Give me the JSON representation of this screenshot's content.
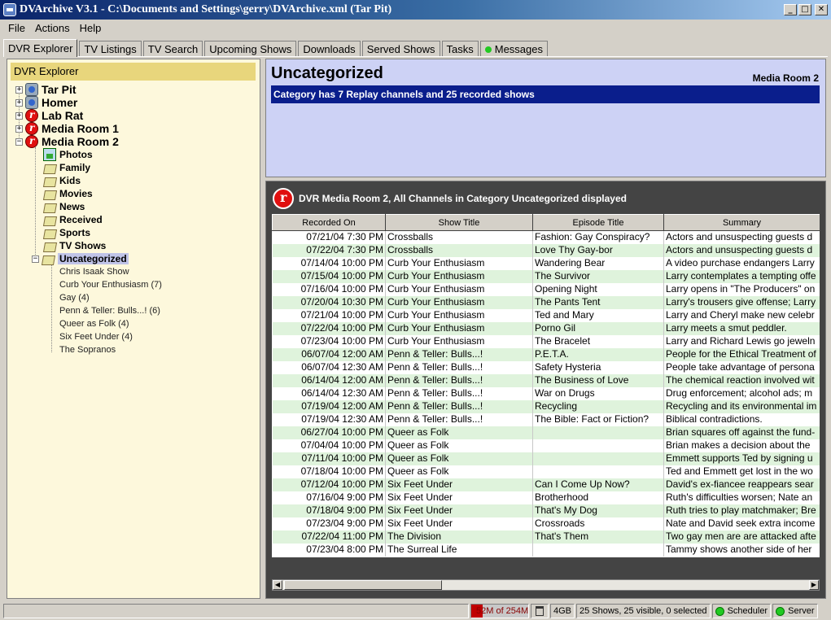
{
  "window": {
    "title": "DVArchive V3.1 - C:\\Documents and Settings\\gerry\\DVArchive.xml (Tar Pit)",
    "minimize": "_",
    "maximize": "□",
    "close": "✕"
  },
  "menu": [
    "File",
    "Actions",
    "Help"
  ],
  "tabs": [
    "DVR Explorer",
    "TV Listings",
    "TV Search",
    "Upcoming Shows",
    "Downloads",
    "Served Shows",
    "Tasks",
    "Messages"
  ],
  "explorer": {
    "heading": "DVR Explorer",
    "dvrs": [
      "Tar Pit",
      "Homer",
      "Lab Rat",
      "Media Room 1",
      "Media Room 2"
    ],
    "categories": [
      "Photos",
      "Family",
      "Kids",
      "Movies",
      "News",
      "Received",
      "Sports",
      "TV Shows",
      "Uncategorized"
    ],
    "shows": [
      "Chris Isaak Show",
      "Curb Your Enthusiasm (7)",
      "Gay (4)",
      "Penn & Teller: Bulls...! (6)",
      "Queer as Folk (4)",
      "Six Feet Under (4)",
      "The Sopranos"
    ]
  },
  "category": {
    "title": "Uncategorized",
    "dvr": "Media Room 2",
    "info": "Category has 7 Replay channels and 25 recorded shows"
  },
  "shows_panel": {
    "heading": "DVR Media Room 2, All Channels in Category Uncategorized displayed"
  },
  "table": {
    "columns": [
      "Recorded On",
      "Show Title",
      "Episode Title",
      "Summary"
    ],
    "rows": [
      [
        "07/21/04 7:30 PM",
        "Crossballs",
        "Fashion: Gay Conspiracy?",
        "Actors and unsuspecting guests d"
      ],
      [
        "07/22/04 7:30 PM",
        "Crossballs",
        "Love Thy Gay-bor",
        "Actors and unsuspecting guests d"
      ],
      [
        "07/14/04 10:00 PM",
        "Curb Your Enthusiasm",
        "Wandering Bear",
        "A video purchase endangers Larry"
      ],
      [
        "07/15/04 10:00 PM",
        "Curb Your Enthusiasm",
        "The Survivor",
        "Larry contemplates a tempting offe"
      ],
      [
        "07/16/04 10:00 PM",
        "Curb Your Enthusiasm",
        "Opening Night",
        "Larry opens in \"The Producers\" on"
      ],
      [
        "07/20/04 10:30 PM",
        "Curb Your Enthusiasm",
        "The Pants Tent",
        "Larry's trousers give offense; Larry"
      ],
      [
        "07/21/04 10:00 PM",
        "Curb Your Enthusiasm",
        "Ted and Mary",
        "Larry and Cheryl make new celebr"
      ],
      [
        "07/22/04 10:00 PM",
        "Curb Your Enthusiasm",
        "Porno Gil",
        "Larry meets a smut peddler."
      ],
      [
        "07/23/04 10:00 PM",
        "Curb Your Enthusiasm",
        "The Bracelet",
        "Larry and Richard Lewis go jeweln"
      ],
      [
        "06/07/04 12:00 AM",
        "Penn & Teller: Bulls...!",
        "P.E.T.A.",
        "People for the Ethical Treatment of"
      ],
      [
        "06/07/04 12:30 AM",
        "Penn & Teller: Bulls...!",
        "Safety Hysteria",
        "People take advantage of persona"
      ],
      [
        "06/14/04 12:00 AM",
        "Penn & Teller: Bulls...!",
        "The Business of Love",
        "The chemical reaction involved wit"
      ],
      [
        "06/14/04 12:30 AM",
        "Penn & Teller: Bulls...!",
        "War on Drugs",
        "Drug enforcement; alcohol ads; m"
      ],
      [
        "07/19/04 12:00 AM",
        "Penn & Teller: Bulls...!",
        "Recycling",
        "Recycling and its environmental im"
      ],
      [
        "07/19/04 12:30 AM",
        "Penn & Teller: Bulls...!",
        "The Bible: Fact or Fiction?",
        "Biblical contradictions."
      ],
      [
        "06/27/04 10:00 PM",
        "Queer as Folk",
        "",
        "Brian squares off against the fund-"
      ],
      [
        "07/04/04 10:00 PM",
        "Queer as Folk",
        "",
        "Brian makes a decision about the"
      ],
      [
        "07/11/04 10:00 PM",
        "Queer as Folk",
        "",
        "Emmett supports Ted by signing u"
      ],
      [
        "07/18/04 10:00 PM",
        "Queer as Folk",
        "",
        "Ted and Emmett get lost in the wo"
      ],
      [
        "07/12/04 10:00 PM",
        "Six Feet Under",
        "Can I Come Up Now?",
        "David's ex-fiancee reappears sear"
      ],
      [
        "07/16/04 9:00 PM",
        "Six Feet Under",
        "Brotherhood",
        "Ruth's difficulties worsen; Nate an"
      ],
      [
        "07/18/04 9:00 PM",
        "Six Feet Under",
        "That's My Dog",
        "Ruth tries to play matchmaker; Bre"
      ],
      [
        "07/23/04 9:00 PM",
        "Six Feet Under",
        "Crossroads",
        "Nate and David seek extra income"
      ],
      [
        "07/22/04 11:00 PM",
        "The Division",
        "That's Them",
        "Two gay men are are attacked afte"
      ],
      [
        "07/23/04 8:00 PM",
        "The Surreal Life",
        "",
        "Tammy shows another side of her"
      ]
    ]
  },
  "statusbar": {
    "message": "",
    "memory": "52M of 254M",
    "memory_used_fraction": 0.2,
    "disk": "4GB",
    "counts": "25 Shows, 25 visible, 0 selected",
    "scheduler": "Scheduler",
    "server": "Server"
  }
}
